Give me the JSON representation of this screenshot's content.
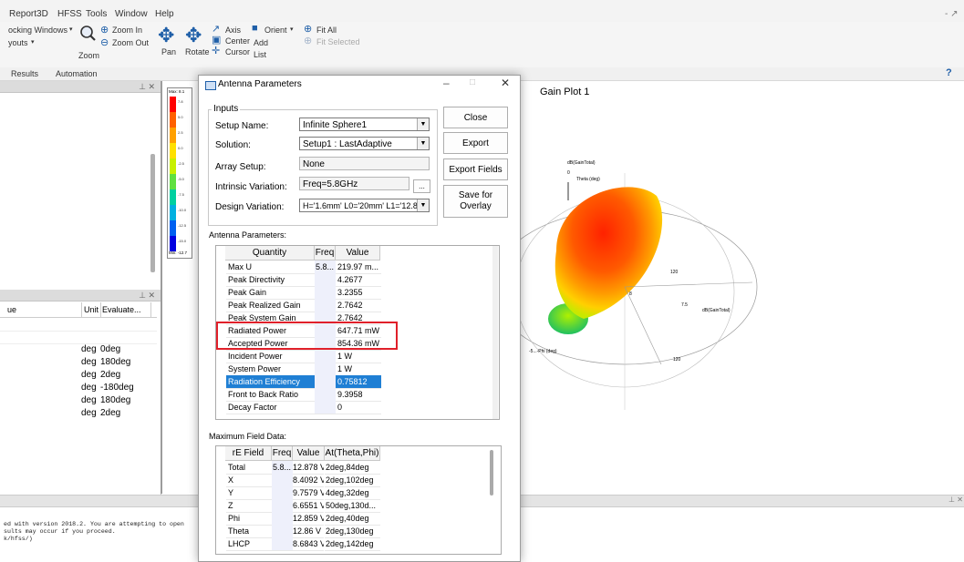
{
  "app": {
    "title_fragment": "Report3D  HFSS  Tools  Window  Help",
    "menu": [
      "Report3D",
      "HFSS",
      "Tools",
      "Window",
      "Help"
    ],
    "window_controls": "- ↗"
  },
  "ribbon": {
    "docking_windows": "ocking Windows",
    "layouts": "youts",
    "zoom_in": "Zoom In",
    "zoom_out": "Zoom Out",
    "zoom": "Zoom",
    "pan": "Pan",
    "rotate": "Rotate",
    "axis": "Axis",
    "center": "Center",
    "cursor": "Cursor",
    "orient": "Orient",
    "add": "Add",
    "list": "List",
    "fit_all": "Fit All",
    "fit_selected": "Fit Selected"
  },
  "results_bar": {
    "results": "Results",
    "automation": "Automation"
  },
  "legend": {
    "max_label": "Max: 8.1",
    "min_label": "Min: -12.7",
    "ticks": [
      "7.8",
      "5.0",
      "2.5",
      "0.0",
      "-2.5",
      "-5.0",
      "-7.5",
      "-10.0",
      "-12.5",
      "-15.0"
    ],
    "colors": [
      "#ff0000",
      "#ff6000",
      "#ffa000",
      "#ffe000",
      "#c8f000",
      "#60e040",
      "#00d0a0",
      "#00b0e0",
      "#0060f0",
      "#0000e0"
    ]
  },
  "properties": {
    "header_value": "ue",
    "header_unit": "Unit",
    "header_eval": "Evaluate...",
    "rows": [
      {
        "unit": "deg",
        "eval": "0deg"
      },
      {
        "unit": "deg",
        "eval": "180deg"
      },
      {
        "unit": "deg",
        "eval": "2deg"
      },
      {
        "unit": "deg",
        "eval": "-180deg"
      },
      {
        "unit": "deg",
        "eval": "180deg"
      },
      {
        "unit": "deg",
        "eval": "2deg"
      }
    ]
  },
  "messages": {
    "line1": "ed with version 2018.2. You are attempting to open",
    "line2": "sults may occur if you proceed.",
    "line3": "k/hfss/)"
  },
  "plot": {
    "title": "Gain Plot 1",
    "legend_label": "dB(GainTotal)",
    "top_tick": "0",
    "theta_label": "Theta (deg)",
    "right_label": "dB(GainTotal)",
    "tick_120_a": "120",
    "tick_120_b": "120",
    "tick_75": "7.5",
    "tick_8": "8",
    "phi_label": "-5...-Phi (deg)"
  },
  "dialog": {
    "title": "Antenna Parameters",
    "inputs_group": "Inputs",
    "setup_name_label": "Setup Name:",
    "setup_name_value": "Infinite Sphere1",
    "solution_label": "Solution:",
    "solution_value": "Setup1 : LastAdaptive",
    "array_setup_label": "Array Setup:",
    "array_setup_value": "None",
    "intrinsic_label": "Intrinsic Variation:",
    "intrinsic_value": "Freq=5.8GHz",
    "ellipsis": "...",
    "design_label": "Design Variation:",
    "design_value": "H='1.6mm' L0='20mm' L1='12.8m",
    "close_btn": "Close",
    "export_btn": "Export",
    "export_fields_btn": "Export Fields",
    "save_overlay_btn_1": "Save for",
    "save_overlay_btn_2": "Overlay",
    "antenna_params_label": "Antenna Parameters:",
    "param_headers": [
      "Quantity",
      "Freq",
      "Value"
    ],
    "params": [
      {
        "q": "Max U",
        "f": "5.8...",
        "v": "219.97 m..."
      },
      {
        "q": "Peak Directivity",
        "f": "",
        "v": "4.2677"
      },
      {
        "q": "Peak Gain",
        "f": "",
        "v": "3.2355"
      },
      {
        "q": "Peak Realized Gain",
        "f": "",
        "v": "2.7642"
      },
      {
        "q": "Peak System Gain",
        "f": "",
        "v": "2.7642"
      },
      {
        "q": "Radiated Power",
        "f": "",
        "v": "647.71 mW"
      },
      {
        "q": "Accepted Power",
        "f": "",
        "v": "854.36 mW"
      },
      {
        "q": "Incident Power",
        "f": "",
        "v": "1 W"
      },
      {
        "q": "System Power",
        "f": "",
        "v": "1 W"
      },
      {
        "q": "Radiation Efficiency",
        "f": "",
        "v": "0.75812"
      },
      {
        "q": "Front to Back Ratio",
        "f": "",
        "v": "9.3958"
      },
      {
        "q": "Decay Factor",
        "f": "",
        "v": "0"
      }
    ],
    "max_field_label": "Maximum Field Data:",
    "field_headers": [
      "rE Field",
      "Freq",
      "Value",
      "At(Theta,Phi)"
    ],
    "fields": [
      {
        "n": "Total",
        "f": "5.8...",
        "v": "12.878 V",
        "a": "2deg,84deg"
      },
      {
        "n": "X",
        "f": "",
        "v": "8.4092 V",
        "a": "2deg,102deg"
      },
      {
        "n": "Y",
        "f": "",
        "v": "9.7579 V",
        "a": "4deg,32deg"
      },
      {
        "n": "Z",
        "f": "",
        "v": "6.6551 V",
        "a": "50deg,130d..."
      },
      {
        "n": "Phi",
        "f": "",
        "v": "12.859 V",
        "a": "2deg,40deg"
      },
      {
        "n": "Theta",
        "f": "",
        "v": "12.86 V",
        "a": "2deg,130deg"
      },
      {
        "n": "LHCP",
        "f": "",
        "v": "8.6843 V",
        "a": "2deg,142deg"
      }
    ]
  }
}
